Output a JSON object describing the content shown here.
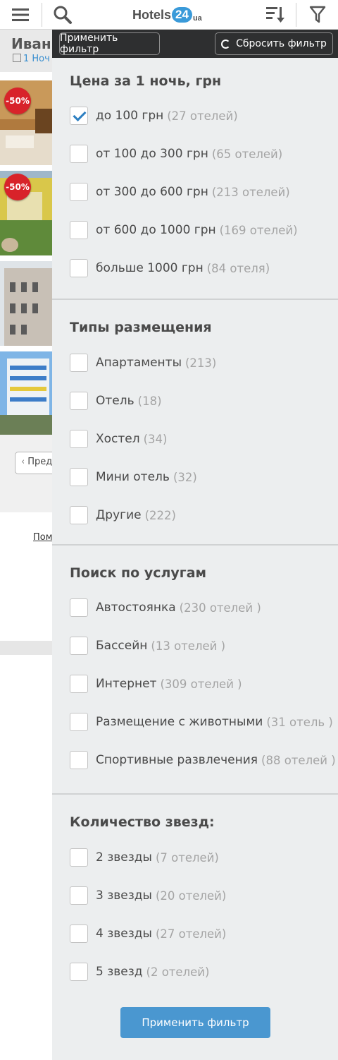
{
  "header": {
    "logo_text": "Hotels",
    "logo_num": "24",
    "logo_suffix": "ua"
  },
  "background": {
    "title": "Иван",
    "subtitle": "1 Ноч",
    "discount_badges": [
      "-50%",
      "-50%"
    ],
    "prev_button": "Пред",
    "help_link": "Пом"
  },
  "panel": {
    "apply_top": "Применить фильтр",
    "reset": "Сбросить фильтр",
    "apply_bottom": "Применить фильтр",
    "sections": [
      {
        "title": "Цена за 1 ночь, грн",
        "options": [
          {
            "label": "до 100 грн",
            "count": "(27 отелей)",
            "checked": true
          },
          {
            "label": "от 100 до 300 грн",
            "count": "(65 отелей)",
            "checked": false
          },
          {
            "label": "от 300 до 600 грн",
            "count": "(213 отелей)",
            "checked": false
          },
          {
            "label": "от 600 до 1000 грн",
            "count": "(169 отелей)",
            "checked": false
          },
          {
            "label": "больше 1000 грн",
            "count": "(84 отеля)",
            "checked": false
          }
        ]
      },
      {
        "title": "Типы размещения",
        "options": [
          {
            "label": "Апартаменты",
            "count": "(213)",
            "checked": false
          },
          {
            "label": "Отель",
            "count": "(18)",
            "checked": false
          },
          {
            "label": "Хостел",
            "count": "(34)",
            "checked": false
          },
          {
            "label": "Мини отель",
            "count": "(32)",
            "checked": false
          },
          {
            "label": "Другие",
            "count": "(222)",
            "checked": false
          }
        ]
      },
      {
        "title": "Поиск по услугам",
        "options": [
          {
            "label": "Автостоянка",
            "count": "(230 отелей )",
            "checked": false
          },
          {
            "label": "Бассейн",
            "count": "(13 отелей )",
            "checked": false
          },
          {
            "label": "Интернет",
            "count": "(309 отелей )",
            "checked": false
          },
          {
            "label": "Размещение с животными",
            "count": "(31 отель )",
            "checked": false
          },
          {
            "label": "Спортивные развлечения",
            "count": "(88 отелей )",
            "checked": false
          }
        ]
      },
      {
        "title": "Количество звезд:",
        "options": [
          {
            "label": "2 звезды",
            "count": "(7 отелей)",
            "checked": false
          },
          {
            "label": "3 звезды",
            "count": "(20 отелей)",
            "checked": false
          },
          {
            "label": "4 звезды",
            "count": "(27 отелей)",
            "checked": false
          },
          {
            "label": "5 звезд",
            "count": "(2 отелей)",
            "checked": false
          }
        ]
      }
    ]
  },
  "colors": {
    "accent": "#4a97d0",
    "panel_bg": "#eceeef",
    "header_dark": "#2e2f30",
    "badge_red": "#d8232a"
  }
}
